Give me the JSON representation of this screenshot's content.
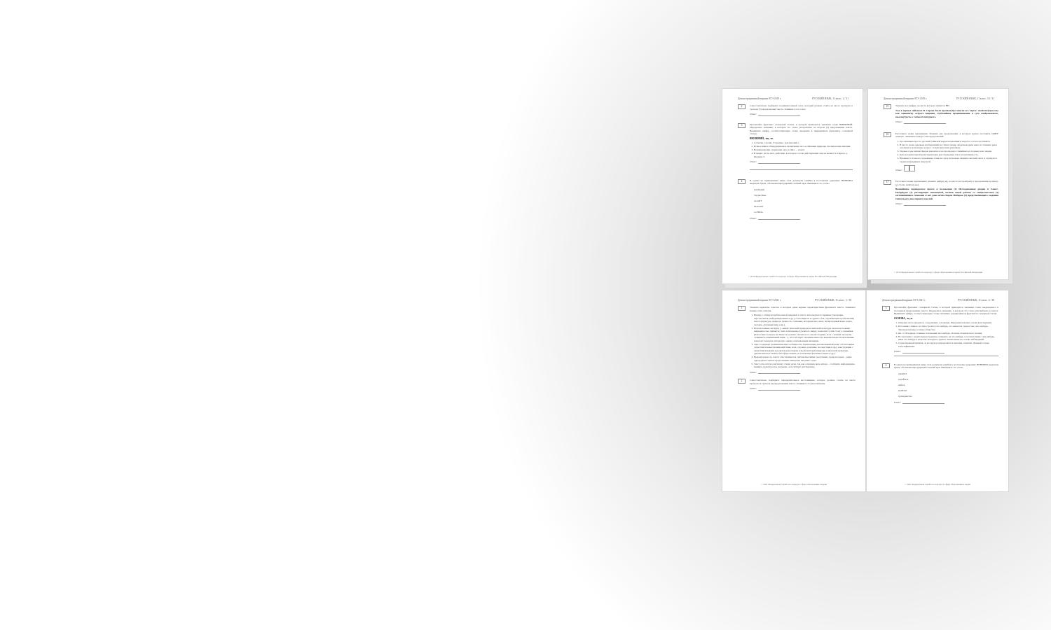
{
  "pages": [
    {
      "header_left": "Демонстрационный вариант ЕГЭ 2019 г.",
      "header_right": "РУССКИЙ ЯЗЫК, 11 класс.   2 / 31",
      "tasks": [
        {
          "num": "2",
          "text": "Самостоятельно подберите подчинительный союз, который должен стоять на месте пропуска в третьем (3) предложении текста. Запишите этот союз.",
          "answer": "Ответ: "
        },
        {
          "num": "3",
          "text": "Прочитайте фрагмент словарной статьи, в которой приводятся значения слова ВНЕШНИЙ. Определите значение, в котором это слово употреблено во втором (2) предложении текста. Выпишите цифру, соответствующую этому значению в приведённом фрагменте словарной статьи.",
          "answer": "Ответ: "
        },
        {
          "num": "4",
          "text": "В одном из приведённых ниже слов допущена ошибка в постановке ударения: НЕВЕРНО выделена буква, обозначающая ударный гласный звук. Выпишите это слово.",
          "answer": "Ответ: "
        }
      ],
      "dict_head": "ВНЕШНИЙ, -яя, -ее.",
      "dict_items": [
        "Событие, случай. Странные, трагический с.",
        "Всякое живое обнаруживаемое проявление чего-н. Явления природы. Космические явления.",
        "Возникновение, появление чего-н. Явл. ... разум.",
        "В цирке: часть акта, действие, в котором состав действующих лиц не меняется. Первое д. Явление 3."
      ],
      "words": [
        "взяЛАний",
        "Торты/сёвы",
        "звонИТ",
        "включИт",
        "соЛИать"
      ],
      "footer": "© 2019 Федеральная служба по надзору в сфере образования и науки Российской Федерации"
    },
    {
      "header_left": "Демонстрационный вариант ЕГЭ 2019 г.",
      "header_right": "РУССКИЙ ЯЗЫК, 11 класс.   10 / 31",
      "tasks": [
        {
          "num": "15",
          "text": "Укажите все цифры, на месте которых пишется НН.",
          "bold": "Уже в первых пейзажах В. Серова были проявле(1)ы многие его черты: свойстве(2)ые ему как живописцу острота видения, глубочайшее проникновение в суть изображаемого, взыска(3)ость к точности натурного.",
          "answer": "Ответ: "
        },
        {
          "num": "16",
          "text": "Расставьте знаки препинания. Укажите два предложения, в которых нужно поставить ОДНУ запятую. Запишите номера этих предложений.",
          "items": [
            "Посланников просто русский тайнской корреспонденции и надолго остается в памяти.",
            "В место своих деревьев изображений на стенах пещер люди выходили вниз по течению реки человека и возможные узоры с геометрическим рисунком.",
            "Первые годы жизни Джорж внезапно и не пропадая в стихийных и спорных нам людям.",
            "Для положительной речи характерна как обращение так и малоизменность.",
            "Впервые в стоны восторженные тоны не сразу несколько зимним светлый свете и отращался серии неправдивых изнутрей."
          ],
          "answer": "Ответ: "
        },
        {
          "num": "17",
          "text": "Расставьте знаки препинания: укажите цифру(-ы), на месте которой(-ых) в предложении должна(-ы) стоять запятая(-ые).",
          "bold": "Важнейшим переворотом прессе в положении (1) Исследованная дворец в Санкт-Петербурге (2) реставрация знаменитой, полная своей работы со специалистами (3) состоявшимися ставками и вот даже иства Карла Фаберже (4) представляющего создания гениального ювелирных изделий.",
          "answer": "Ответ: "
        }
      ],
      "footer": "© 2019 Федеральная служба по надзору в сфере образования и науки Российской Федерации"
    },
    {
      "header_left": "Демонстрационный вариант ЕГЭ 2021 г.",
      "header_right": "РУССКИЙ ЯЗЫК, 11 класс.   3 / 38",
      "tasks": [
        {
          "num": "1",
          "text": "Укажите варианты ответов, в которых даны верные характеристики фрагмента текста. Запишите номера этих ответов.",
          "items": [
            "Наряду с общеупотребительной лексикой в тексте используются термины (эволюция, персональная, информационных и др.), относящиеся к группе слов, отражающих проблематику текста (культура, природа, ценность, сознание, историческое опыт, литературный язык, наука, человек, духовный мир и др.).",
            "Использование метафор (...живёт лихтокой природы и лихтокой культуры ли казался языки; невидимостью приметы; смех и лихоканье духовного мира), позволяет (этой-стоят), сравнивая (Как ясные лоскуты на Земле не должно оказаться со своей спорами, всех с земной экологии, стоящиеся в первичный, язык ...), способствует эмоциональности, выразительности изложения, помогает передать авторскую оценку описываемым явлениям.",
            "Текст содержит грамматические особенности, характерные для письменной речи: отглагольные существительные (взаимодействия, всех, огромна, разумны, последствия и др.), конструкции с существительными в родительном падеже (своей лихтокой природы и лихтокой культуры, диалектическое земное биосферы жизнь, и положение феномена жерёх и др.).",
            "Выразительность текста обеспечивается синтаксическими средствами, среди которых – ряды однородных членов предложения, инверсия, вводные слова.",
            "Текст относится к научному стилю речи, так как основная цель автора – сообщить информацию, выявить практическое значение, дать чёткую инструкцию."
          ],
          "answer": "Ответ: "
        },
        {
          "num": "2",
          "text": "Самостоятельно подберите определительное местоимение, которое должно стоять на месте пропуска в третьем (3) предложении текста. Запишите это местоимение.",
          "answer": "Ответ: "
        }
      ],
      "footer": "© 2021 Федеральная служба по надзору в сфере образования и науки"
    },
    {
      "header_left": "Демонстрационный вариант ЕГЭ 2021 г.",
      "header_right": "РУССКИЙ ЯЗЫК, 11 класс.   4 / 38",
      "tasks": [
        {
          "num": "3",
          "text": "Прочитайте фрагмент словарной статьи, в которой приводятся значения слова, выделенного в последнем предложении текста. Определите значение, в котором это слово употреблено в тексте. Выпишите цифру, соответствующую этому значению в приведённом фрагменте словарной статьи.",
          "answer": "Ответ: "
        },
        {
          "num": "4",
          "text": "В одном из приведённых ниже слов допущена ошибка в постановке ударения: НЕВЕРНО выделена буква, обозначающая ударный гласный звук. Выпишите это слово.",
          "answer": "Ответ: "
        }
      ],
      "dict_head": "ОСНОВА, -ы, ж.",
      "dict_items": [
        "Опорная часть предмета, сооружения, основание. Фундаментальная основа конструкции.",
        "Источник, главное, на чём строится что-нибудь, что является сущностью чего-нибудь. Законодательные основы общества.",
        "мн. ч. Исходные, главные положения чего-нибудь. Основы технического знания.",
        "В сочетании с родительным падежом, опираясь на что-нибудь, в соответствии с чем-нибудь, имея что-нибудь в качестве исходного пункта. Заключение на основе наблюдений.",
        "Существенный признак, за которую распределяются явления, понятия. Данный основа классификации."
      ],
      "words": [
        "закрЫЛ",
        "кралЁмся",
        "вайнА",
        "вклЮчё",
        "грАжданство"
      ],
      "footer": "© 2021 Федеральная служба по надзору в сфере образования и науки"
    }
  ]
}
